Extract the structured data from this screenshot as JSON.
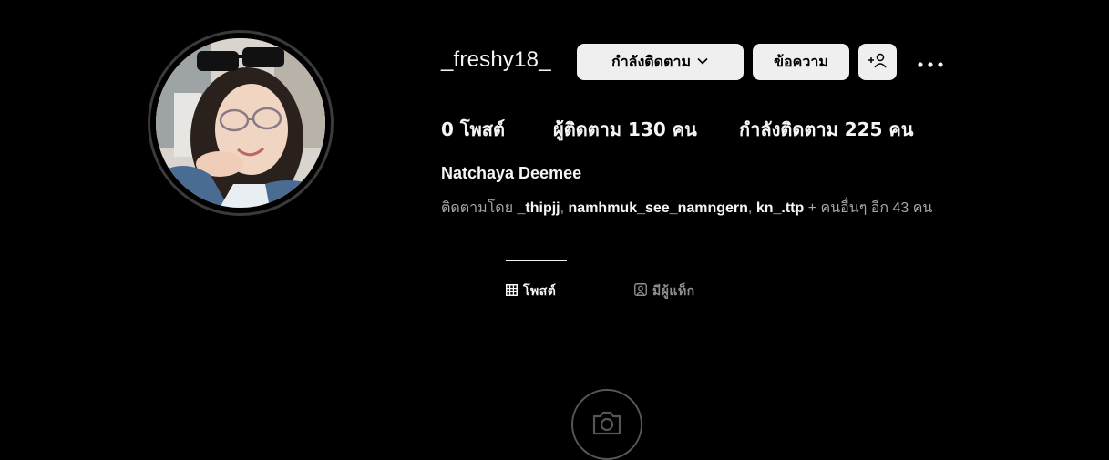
{
  "profile": {
    "username": "_freshy18_",
    "full_name": "Natchaya Deemee",
    "avatar_alt": "profile-photo"
  },
  "actions": {
    "following_label": "กำลังติดตาม",
    "message_label": "ข้อความ",
    "add_user_icon": "add-user-icon",
    "more_icon": "more-options-icon"
  },
  "stats": {
    "posts": "0 โพสต์",
    "followers": "ผู้ติดตาม 130 คน",
    "following": "กำลังติดตาม 225 คน"
  },
  "followed_by": {
    "prefix": "ติดตามโดย ",
    "users": [
      "_thipjj",
      "namhmuk_see_namngern",
      "kn_.ttp"
    ],
    "suffix": " + คนอื่นๆ อีก 43 คน"
  },
  "tabs": [
    {
      "label": "โพสต์",
      "icon": "grid-icon",
      "active": true
    },
    {
      "label": "มีผู้แท็ก",
      "icon": "tagged-icon",
      "active": false
    }
  ],
  "empty_state": {
    "icon": "camera-icon"
  },
  "colors": {
    "background": "#000000",
    "button_bg": "#efefef",
    "text_primary": "#f5f5f5",
    "text_secondary": "#a8a8a8",
    "divider": "#2f2f2f"
  }
}
